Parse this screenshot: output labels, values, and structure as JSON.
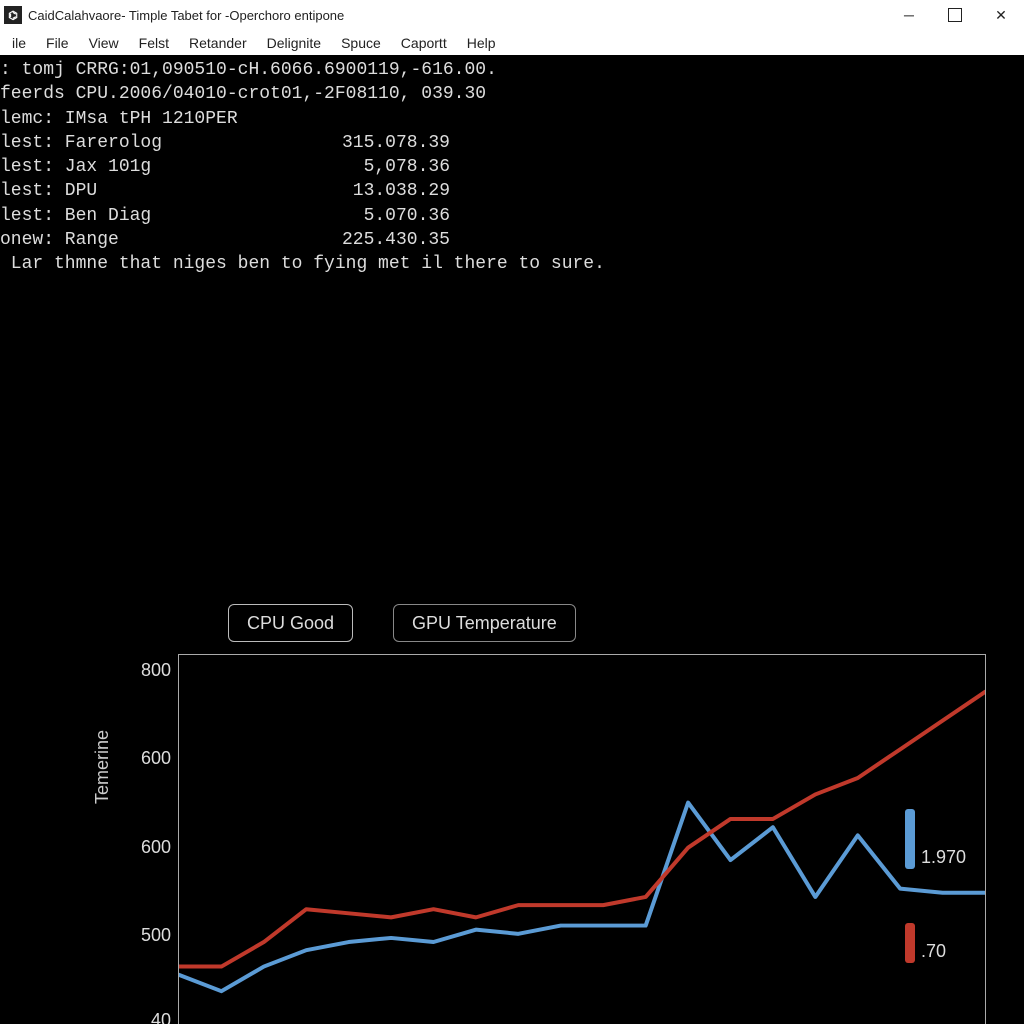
{
  "window": {
    "title": "CaidCalahvaore- Timple Tabet for -Operchoro entipone",
    "icon_glyph": "⌬"
  },
  "menubar": {
    "items": [
      "ile",
      "File",
      "View",
      "Felst",
      "Retander",
      "Delignite",
      "Spuce",
      "Caportt",
      "Help"
    ]
  },
  "terminal": {
    "lines": [
      ": tomj CRRG:01,090510-cH.6066.6900119,-616.00.",
      "feerds CPU.2006/04010-crot01,-2F08110, 039.30"
    ],
    "blank": "",
    "header": "lemc: IMsa tPH 1210PER",
    "rows": [
      {
        "label": "lest: Farerolog",
        "value": "315.078.39"
      },
      {
        "label": "lest: Jax 101g",
        "value": "5,078.36"
      },
      {
        "label": "lest: DPU",
        "value": "13.038.29"
      },
      {
        "label": "lest: Ben Diag",
        "value": "5.070.36"
      },
      {
        "label": "onew: Range",
        "value": "225.430.35"
      }
    ],
    "note": " Lar thmne that niges ben to fying met il there to sure."
  },
  "chart": {
    "tabs": [
      {
        "label": "CPU Good",
        "active": true
      },
      {
        "label": "GPU Temperature",
        "active": false
      }
    ],
    "ylabel": "Temerine",
    "yticks": [
      "800",
      "600",
      "600",
      "500",
      "40"
    ],
    "legend": [
      {
        "color": "#5b9bd5",
        "value": "1.970"
      },
      {
        "color": "#c0392b",
        "value": ".70"
      }
    ]
  },
  "chart_data": {
    "type": "line",
    "title": "",
    "xlabel": "",
    "ylabel": "Temerine",
    "ylim": [
      400,
      850
    ],
    "x": [
      0,
      1,
      2,
      3,
      4,
      5,
      6,
      7,
      8,
      9,
      10,
      11,
      12,
      13,
      14,
      15,
      16,
      17,
      18,
      19
    ],
    "series": [
      {
        "name": "CPU Good",
        "color": "#5b9bd5",
        "values": [
          460,
          440,
          470,
          490,
          500,
          505,
          500,
          515,
          510,
          520,
          520,
          520,
          670,
          600,
          640,
          555,
          630,
          565,
          560,
          560
        ]
      },
      {
        "name": "GPU Temperature",
        "color": "#c0392b",
        "values": [
          470,
          470,
          500,
          540,
          535,
          530,
          540,
          530,
          545,
          545,
          545,
          555,
          615,
          650,
          650,
          680,
          700,
          735,
          770,
          805
        ]
      }
    ]
  }
}
